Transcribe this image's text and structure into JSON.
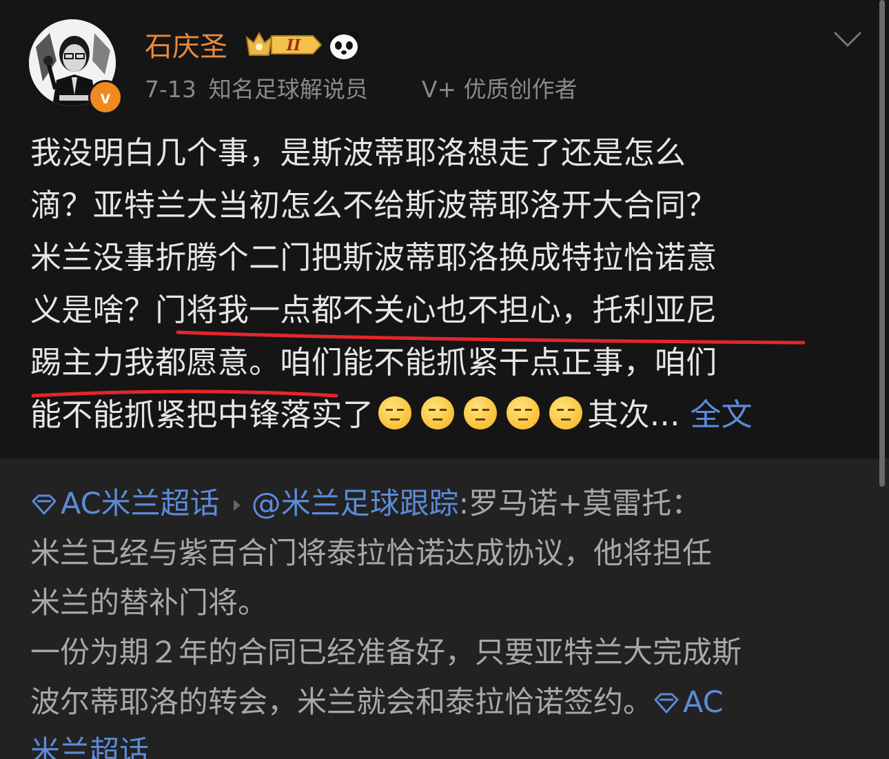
{
  "post": {
    "username": "石庆圣",
    "level_badge": "II",
    "date": "7-13",
    "role": "知名足球解说员",
    "creator_tag": "V+ 优质创作者",
    "verified_mark": "v",
    "lines": {
      "l1": "我没明白几个事，是斯波蒂耶洛想走了还是怎么",
      "l2": "滴？亚特兰大当初怎么不给斯波蒂耶洛开大合同？",
      "l3": "米兰没事折腾个二门把斯波蒂耶洛换成特拉恰诺意",
      "l4": "义是啥？门将我一点都不关心也不担心，托利亚尼",
      "l5": "踢主力我都愿意。咱们能不能抓紧干点正事，咱们",
      "l6": "能不能抓紧把中锋落实了",
      "l6_after": "其次...",
      "full_text": "全文"
    },
    "underline_color": "#e4262b"
  },
  "repost": {
    "topic": "AC米兰超话",
    "mention": "@米兰足球跟踪",
    "l1_rest": ":罗马诺+莫雷托：",
    "l2": "米兰已经与紫百合门将泰拉恰诺达成协议，他将担任",
    "l3": "米兰的替补门将。",
    "l4": "一份为期２年的合同已经准备好，只要亚特兰大完成斯",
    "l5": "波尔蒂耶洛的转会，米兰就会和泰拉恰诺签约。",
    "topic_end_a": "AC",
    "topic_end_b": "米兰超话"
  },
  "colors": {
    "background": "#151515",
    "repost_background": "#222222",
    "username": "#e88a3c",
    "link": "#5b8bd9",
    "verified": "#f08a20"
  }
}
